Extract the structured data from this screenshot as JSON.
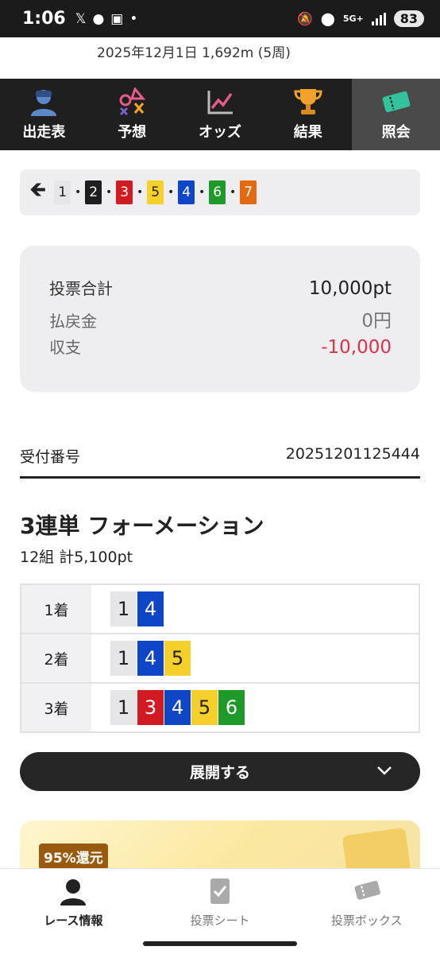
{
  "status_bar": {
    "time": "1:06",
    "network": "5G+",
    "battery": "83"
  },
  "race_info": "2025年12月1日 1,692m (5周)",
  "nav": [
    {
      "label": "出走表",
      "icon": "person-icon",
      "active": false
    },
    {
      "label": "予想",
      "icon": "symbols-icon",
      "active": false
    },
    {
      "label": "オッズ",
      "icon": "chart-line-icon",
      "active": false
    },
    {
      "label": "結果",
      "icon": "trophy-icon",
      "active": false
    },
    {
      "label": "照会",
      "icon": "ticket-icon",
      "active": true
    }
  ],
  "horse_numbers": [
    "1",
    "2",
    "3",
    "5",
    "4",
    "6",
    "7"
  ],
  "summary": {
    "total_label": "投票合計",
    "total_value": "10,000pt",
    "payout_label": "払戻金",
    "payout_value": "0円",
    "balance_label": "収支",
    "balance_value": "-10,000"
  },
  "receipt": {
    "label": "受付番号",
    "number": "20251201125444"
  },
  "bet": {
    "title": "3連単 フォーメーション",
    "subtitle": "12組 計5,100pt",
    "rows": [
      {
        "place": "1着",
        "numbers": [
          "1",
          "4"
        ]
      },
      {
        "place": "2着",
        "numbers": [
          "1",
          "4",
          "5"
        ]
      },
      {
        "place": "3着",
        "numbers": [
          "1",
          "3",
          "4",
          "5",
          "6"
        ]
      }
    ]
  },
  "expand_label": "展開する",
  "promo_badge": "95%還元",
  "bottom_tabs": [
    {
      "label": "レース情報",
      "icon": "person-icon",
      "active": true
    },
    {
      "label": "投票シート",
      "icon": "checklist-icon",
      "active": false
    },
    {
      "label": "投票ボックス",
      "icon": "tickets-icon",
      "active": false
    }
  ],
  "colors": {
    "1": "#e6e6e8",
    "2": "#1f1f1f",
    "3": "#d11a22",
    "4": "#0f46c8",
    "5": "#f5cf2a",
    "6": "#1e9a2b",
    "7": "#e26a12",
    "negative": "#d9324a"
  }
}
